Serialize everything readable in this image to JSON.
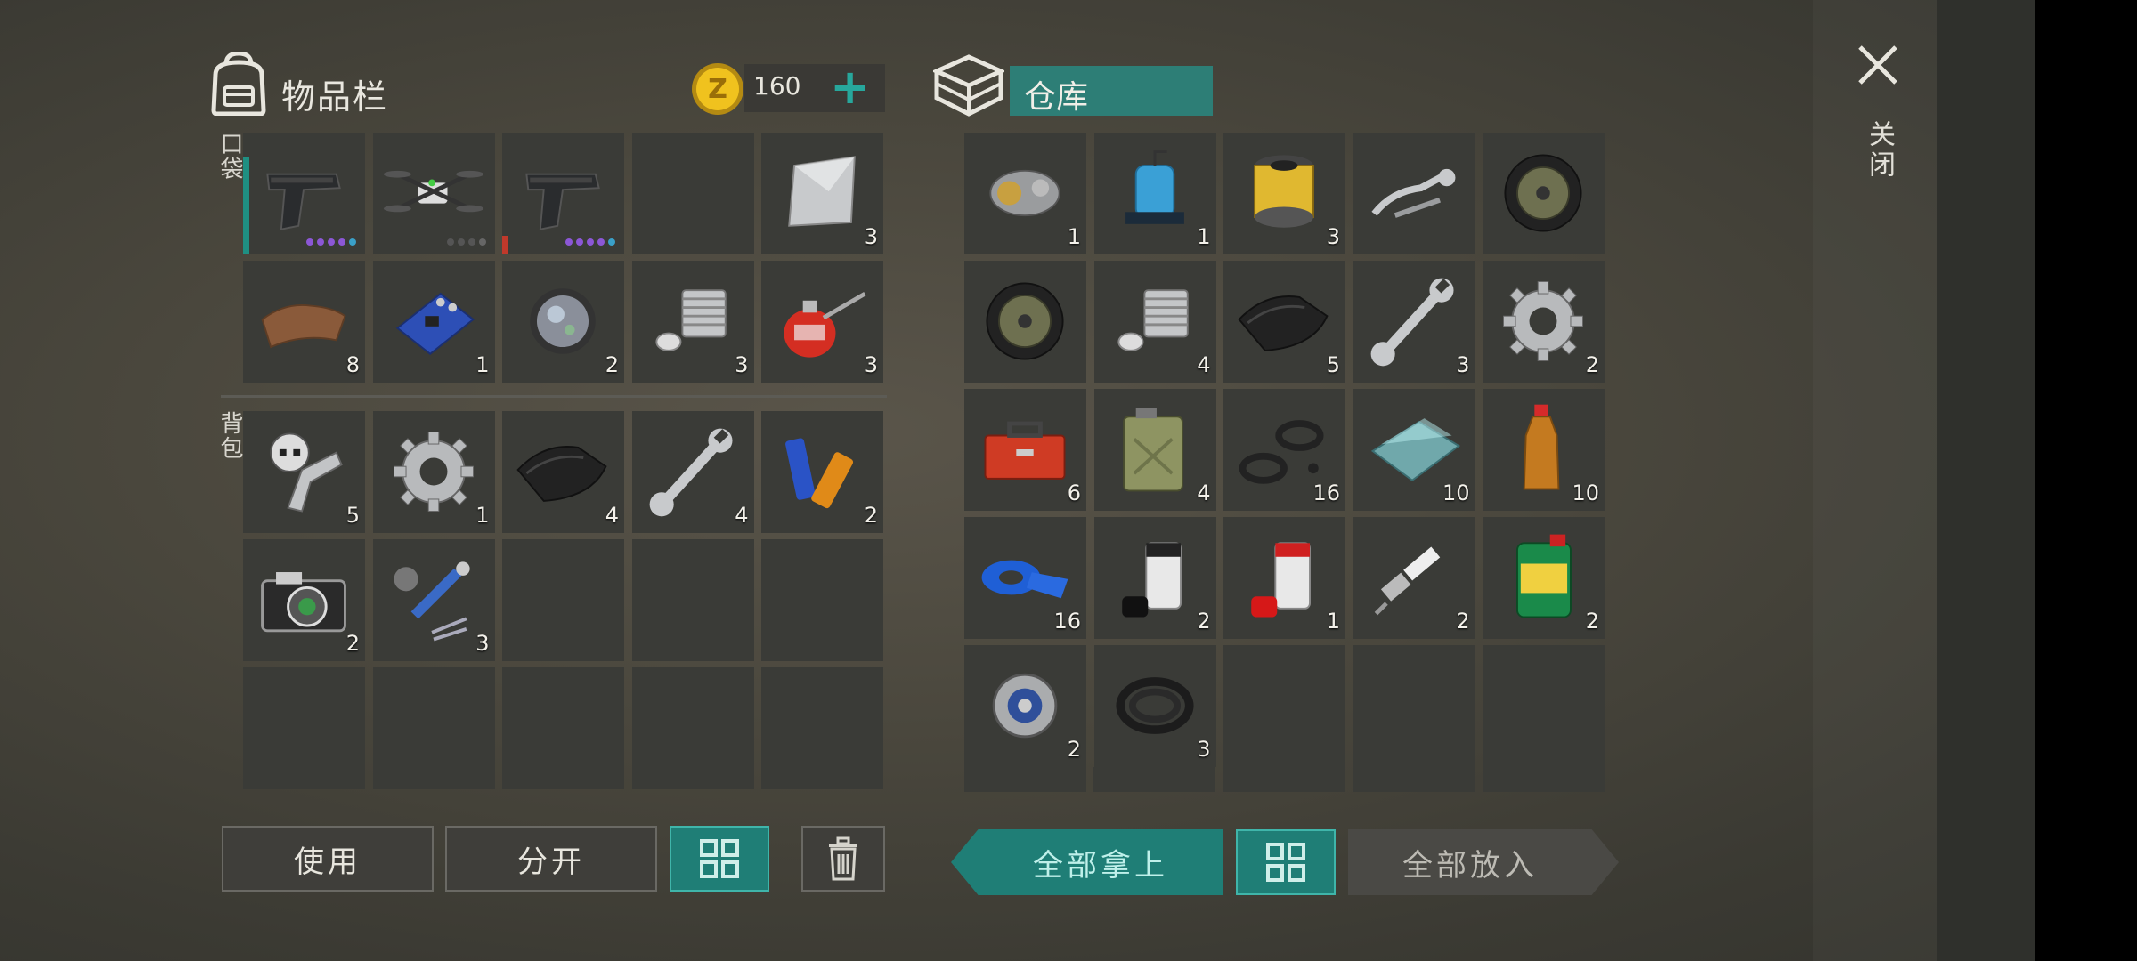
{
  "inventory": {
    "title": "物品栏",
    "coins": "160",
    "plus_label": "+",
    "pocket_label": "口袋",
    "backpack_label": "背包"
  },
  "warehouse": {
    "title": "仓库"
  },
  "close": {
    "label": "关闭"
  },
  "pockets": [
    {
      "icon": "pistol-icon",
      "count": "",
      "durability": 0.8,
      "dur_color": "#1f8f82",
      "dots": [
        "#8c57d6",
        "#8c57d6",
        "#8c57d6",
        "#8c57d6",
        "#3aa0c8"
      ]
    },
    {
      "icon": "drone-icon",
      "count": "",
      "durability": 0,
      "dur_color": "#1f8f82",
      "dots": [
        "#555",
        "#555",
        "#555",
        "#666"
      ]
    },
    {
      "icon": "pistol-icon",
      "count": "",
      "durability": 0.15,
      "dur_color": "#c0392b",
      "dots": [
        "#8c57d6",
        "#8c57d6",
        "#8c57d6",
        "#8c57d6",
        "#3aa0c8"
      ]
    },
    {
      "icon": "empty",
      "count": ""
    },
    {
      "icon": "metal-sheet-icon",
      "count": "3"
    },
    {
      "icon": "leather-icon",
      "count": "8"
    },
    {
      "icon": "circuit-board-icon",
      "count": "1"
    },
    {
      "icon": "lens-icon",
      "count": "2"
    },
    {
      "icon": "engine-cylinder-icon",
      "count": "3"
    },
    {
      "icon": "oil-can-icon",
      "count": "3"
    }
  ],
  "backpack": [
    {
      "icon": "scrap-parts-icon",
      "count": "5"
    },
    {
      "icon": "gear-icon",
      "count": "1"
    },
    {
      "icon": "fabric-icon",
      "count": "4"
    },
    {
      "icon": "wrench-icon",
      "count": "4"
    },
    {
      "icon": "batteries-icon",
      "count": "2"
    },
    {
      "icon": "camera-icon",
      "count": "2"
    },
    {
      "icon": "drone-parts-icon",
      "count": "3"
    },
    {
      "icon": "empty",
      "count": ""
    },
    {
      "icon": "empty",
      "count": ""
    },
    {
      "icon": "empty",
      "count": ""
    },
    {
      "icon": "empty",
      "count": ""
    },
    {
      "icon": "empty",
      "count": ""
    },
    {
      "icon": "empty",
      "count": ""
    },
    {
      "icon": "empty",
      "count": ""
    },
    {
      "icon": "empty",
      "count": ""
    }
  ],
  "storage": [
    {
      "icon": "engine-part-icon",
      "count": "1"
    },
    {
      "icon": "water-pump-icon",
      "count": "1"
    },
    {
      "icon": "air-filter-icon",
      "count": "3"
    },
    {
      "icon": "brake-lever-icon",
      "count": ""
    },
    {
      "icon": "wheel-icon",
      "count": ""
    },
    {
      "icon": "wheel-icon",
      "count": ""
    },
    {
      "icon": "engine-cylinder-icon",
      "count": "4"
    },
    {
      "icon": "fabric-icon",
      "count": "5"
    },
    {
      "icon": "wrench-icon",
      "count": "3"
    },
    {
      "icon": "gear-icon",
      "count": "2"
    },
    {
      "icon": "toolbox-icon",
      "count": "6"
    },
    {
      "icon": "jerrycan-icon",
      "count": "4"
    },
    {
      "icon": "rubber-seals-icon",
      "count": "16"
    },
    {
      "icon": "glass-icon",
      "count": "10"
    },
    {
      "icon": "bottle-icon",
      "count": "10"
    },
    {
      "icon": "duct-tape-icon",
      "count": "16"
    },
    {
      "icon": "spray-paint-black-icon",
      "count": "2"
    },
    {
      "icon": "spray-paint-red-icon",
      "count": "1"
    },
    {
      "icon": "spark-plug-icon",
      "count": "2"
    },
    {
      "icon": "motor-oil-icon",
      "count": "2"
    },
    {
      "icon": "pulley-icon",
      "count": "2"
    },
    {
      "icon": "rubber-hose-icon",
      "count": "3"
    },
    {
      "icon": "empty",
      "count": ""
    },
    {
      "icon": "empty",
      "count": ""
    },
    {
      "icon": "empty",
      "count": ""
    }
  ],
  "buttons": {
    "use": "使用",
    "split": "分开",
    "take_all": "全部拿上",
    "put_all": "全部放入"
  },
  "colors": {
    "accent": "#1f7e76",
    "accent_light": "#3fb5aa",
    "slot": "#3a3b37"
  }
}
